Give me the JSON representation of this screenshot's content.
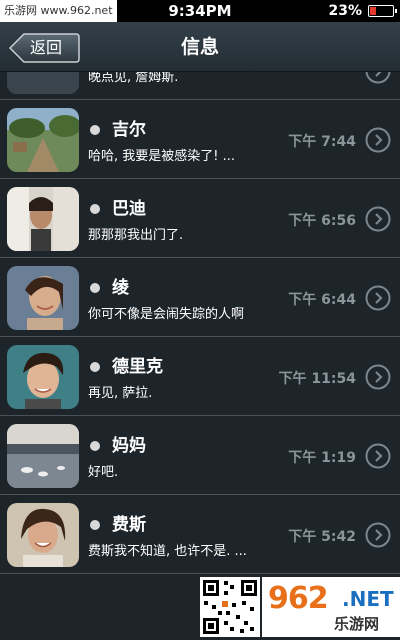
{
  "status_bar": {
    "watermark_text": "乐游网 www.962.net",
    "time": "9:34PM",
    "battery_percent_text": "23%",
    "battery_level": 0.23,
    "battery_color": "#e23b2e"
  },
  "nav": {
    "back_label": "返回",
    "title": "信息"
  },
  "messages": [
    {
      "name": "",
      "preview": "晚点见, 詹姆斯.",
      "time": ""
    },
    {
      "name": "吉尔",
      "preview": "哈哈, 我要是被感染了! ...",
      "time": "下午 7:44"
    },
    {
      "name": "巴迪",
      "preview": "那那那我出门了.",
      "time": "下午 6:56"
    },
    {
      "name": "绫",
      "preview": "你可不像是会闹失踪的人啊",
      "time": "下午 6:44"
    },
    {
      "name": "德里克",
      "preview": "再见, 萨拉.",
      "time": "下午 11:54"
    },
    {
      "name": "妈妈",
      "preview": "好吧.",
      "time": "下午 1:19"
    },
    {
      "name": "费斯",
      "preview": "费斯我不知道, 也许不是. ...",
      "time": "下午 5:42"
    }
  ],
  "footer": {
    "logo_number": "962",
    "logo_domain": ".NET",
    "logo_chinese": "乐游网"
  },
  "colors": {
    "background": "#1d252b",
    "time_text": "#8b9499",
    "logo_orange": "#e9701a",
    "logo_blue": "#1b6fc0"
  }
}
